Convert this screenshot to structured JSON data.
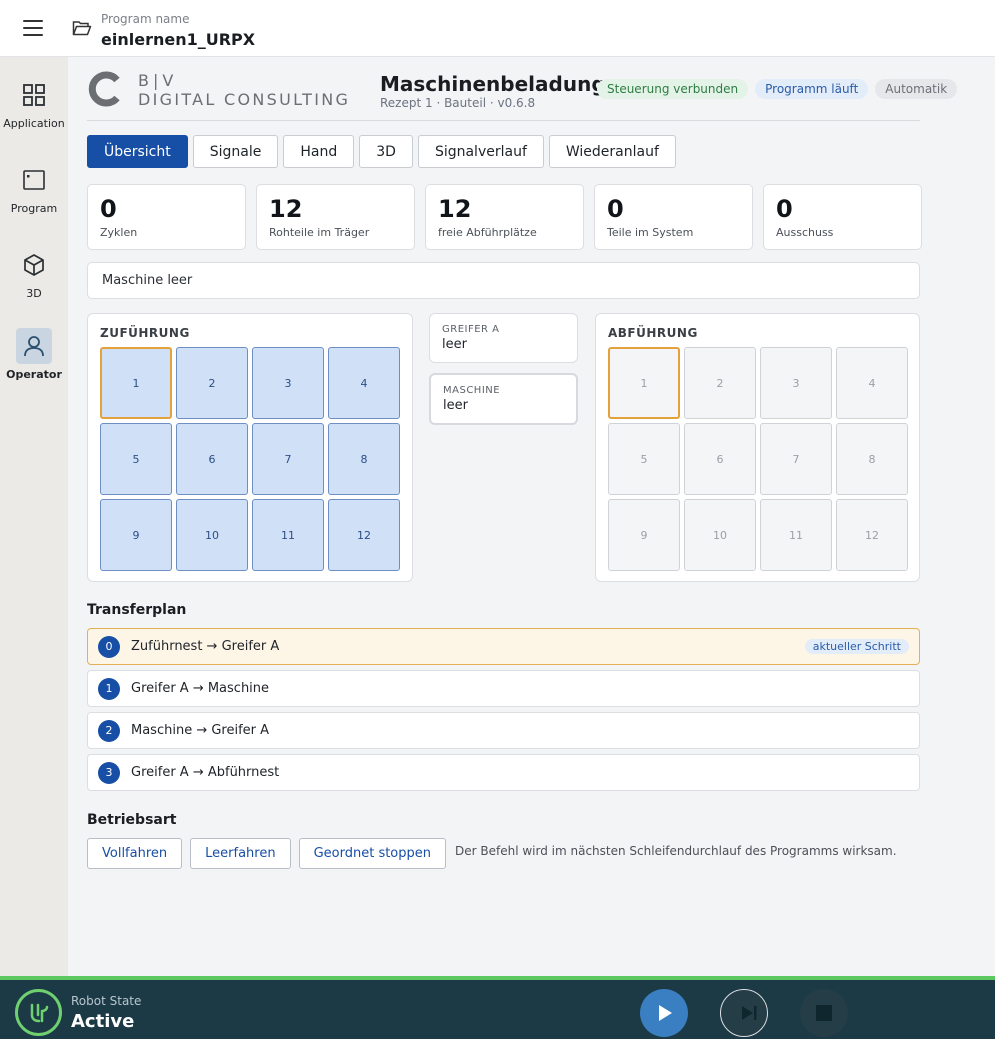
{
  "header": {
    "caption": "Program name",
    "program_name": "einlernen1_URPX"
  },
  "sidenav": {
    "items": [
      {
        "label": "Application",
        "icon": "grid-icon"
      },
      {
        "label": "Program",
        "icon": "program-icon"
      },
      {
        "label": "3D",
        "icon": "cube-icon"
      },
      {
        "label": "Operator",
        "icon": "person-icon",
        "active": true
      }
    ]
  },
  "brand": {
    "line1": "B|V",
    "line2": "DIGITAL CONSULTING"
  },
  "page": {
    "title": "Maschinenbeladung",
    "subtitle": "Rezept 1 · Bauteil · v0.6.8"
  },
  "badges": [
    "Steuerung verbunden",
    "Programm läuft",
    "Automatik"
  ],
  "tabs": [
    "Übersicht",
    "Signale",
    "Hand",
    "3D",
    "Signalverlauf",
    "Wiederanlauf"
  ],
  "stats": [
    {
      "value": "0",
      "label": "Zyklen"
    },
    {
      "value": "12",
      "label": "Rohteile im Träger"
    },
    {
      "value": "12",
      "label": "freie Abführplätze"
    },
    {
      "value": "0",
      "label": "Teile im System"
    },
    {
      "value": "0",
      "label": "Ausschuss"
    }
  ],
  "status_text": "Maschine leer",
  "feed": {
    "title": "ZUFÜHRUNG",
    "cells": [
      "1",
      "2",
      "3",
      "4",
      "5",
      "6",
      "7",
      "8",
      "9",
      "10",
      "11",
      "12"
    ]
  },
  "gripper": {
    "caption": "GREIFER A",
    "value": "leer"
  },
  "machine": {
    "caption": "MASCHINE",
    "value": "leer"
  },
  "discharge": {
    "title": "ABFÜHRUNG",
    "cells": [
      "1",
      "2",
      "3",
      "4",
      "5",
      "6",
      "7",
      "8",
      "9",
      "10",
      "11",
      "12"
    ]
  },
  "transfer": {
    "title": "Transferplan",
    "current_tag": "aktueller Schritt",
    "steps": [
      {
        "num": "0",
        "text": "Zuführnest → Greifer A"
      },
      {
        "num": "1",
        "text": "Greifer A → Maschine"
      },
      {
        "num": "2",
        "text": "Maschine → Greifer A"
      },
      {
        "num": "3",
        "text": "Greifer A → Abführnest"
      }
    ]
  },
  "mode": {
    "title": "Betriebsart",
    "buttons": [
      "Vollfahren",
      "Leerfahren",
      "Geordnet stoppen"
    ],
    "hint": "Der Befehl wird im nächsten Schleifendurchlauf des Programms wirksam."
  },
  "robot": {
    "caption": "Robot State",
    "state": "Active"
  },
  "colors": {
    "primary": "#174ea6",
    "bottom_bar": "#1c3a46",
    "accent_green": "#5bc862",
    "current_outline": "#e3a23c"
  }
}
